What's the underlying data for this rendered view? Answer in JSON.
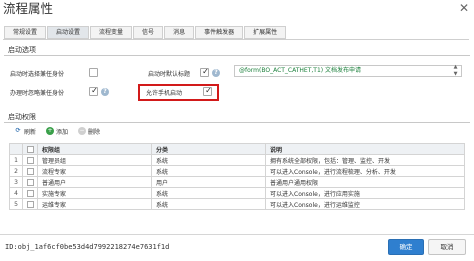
{
  "dialog": {
    "title": "流程属性",
    "close_glyph": "✕"
  },
  "tabs": [
    {
      "label": "常规设置"
    },
    {
      "label": "启动设置"
    },
    {
      "label": "流程变量"
    },
    {
      "label": "信号"
    },
    {
      "label": "消息"
    },
    {
      "label": "事件触发器"
    },
    {
      "label": "扩展属性"
    }
  ],
  "active_tab": 1,
  "start_options": {
    "section_title": "启动选项",
    "select_identity_label": "启动时选择兼任身份",
    "default_title_label": "启动时默认标题",
    "auto_identity_label": "办理时忽略兼任身份",
    "mobile_start_label": "允许手机启动",
    "formula_value": "@form(BO_ACT_CATHET,T1) 文档发布申请",
    "help_glyph": "?",
    "check_glyph": "✓",
    "scroll_glyph": "▲\n▼",
    "select_identity_checked": false,
    "default_title_checked": true,
    "auto_identity_checked": true,
    "mobile_start_checked": true
  },
  "permissions": {
    "section_title": "启动权限",
    "toolbar": {
      "refresh_label": "刷新",
      "add_label": "添加",
      "delete_label": "删除",
      "refresh_glyph": "⟳",
      "add_glyph": "+",
      "delete_glyph": "−"
    },
    "columns": [
      "",
      "",
      "权限组",
      "分类",
      "说明"
    ],
    "rows": [
      {
        "num": "1",
        "group": "管理员组",
        "category": "系统",
        "desc": "拥有系统全部权限，包括：管理、监控、开发"
      },
      {
        "num": "2",
        "group": "流程专家",
        "category": "系统",
        "desc": "可以进入Console，进行流程梳理、分析、开发"
      },
      {
        "num": "3",
        "group": "普通用户",
        "category": "用户",
        "desc": "普通用户通用权限"
      },
      {
        "num": "4",
        "group": "实施专家",
        "category": "系统",
        "desc": "可以进入Console，进行应用实施"
      },
      {
        "num": "5",
        "group": "运维专家",
        "category": "系统",
        "desc": "可以进入Console，进行运维监控"
      }
    ]
  },
  "footer": {
    "id_text": "ID:obj_1af6cf0be53d4d7992218274e7631f1d",
    "ok_label": "确定",
    "cancel_label": "取消"
  },
  "colors": {
    "accent": "#2f7fcf",
    "highlight_border": "#d21a1a",
    "formula_text": "#1a7f3a"
  }
}
